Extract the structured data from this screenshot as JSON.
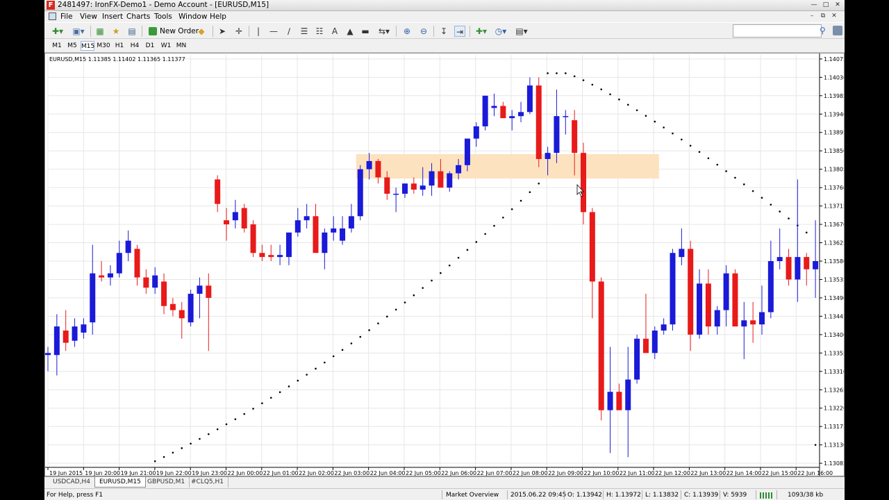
{
  "window": {
    "title": "2481497: IronFX-Demo1 - Demo Account - [EURUSD,M15]",
    "app_icon_letter": "F"
  },
  "menu": {
    "items": [
      "File",
      "View",
      "Insert",
      "Charts",
      "Tools",
      "Window",
      "Help"
    ]
  },
  "toolbar": {
    "new_order_label": "New Order",
    "search_placeholder": ""
  },
  "timeframes": {
    "items": [
      "M1",
      "M5",
      "M15",
      "M30",
      "H1",
      "H4",
      "D1",
      "W1",
      "MN"
    ],
    "active": "M15"
  },
  "chart_header": "EURUSD,M15  1.11385 1.11402 1.11365 1.11377",
  "chart_tabs": {
    "items": [
      "USDCAD,H4",
      "EURUSD,M15",
      "GBPUSD,M1",
      "#CLQ5,H1"
    ],
    "active": "EURUSD,M15"
  },
  "status": {
    "help": "For Help, press F1",
    "profile": "Market Overview",
    "datetime": "2015.06.22 09:45",
    "open": "O: 1.13942",
    "high": "H: 1.13972",
    "low": "L: 1.13832",
    "close": "C: 1.13939",
    "volume": "V: 5939",
    "traffic": "1093/38 kb"
  },
  "colors": {
    "bull": "#1a1ad8",
    "bear": "#e81a1a",
    "zone": "#fde2bf",
    "grid": "#e6e6e6"
  },
  "chart_data": {
    "type": "candlestick",
    "symbol": "EURUSD",
    "timeframe": "M15",
    "y_ticks": [
      "1.14075",
      "1.14030",
      "1.13985",
      "1.13940",
      "1.13895",
      "1.13850",
      "1.13805",
      "1.13760",
      "1.13715",
      "1.13670",
      "1.13625",
      "1.13580",
      "1.13535",
      "1.13490",
      "1.13445",
      "1.13400",
      "1.13355",
      "1.13310",
      "1.13265",
      "1.13220",
      "1.13175",
      "1.13130",
      "1.13085"
    ],
    "x_ticks": [
      "19 Jun 2015",
      "19 Jun 20:00",
      "19 Jun 21:00",
      "19 Jun 22:00",
      "19 Jun 23:00",
      "22 Jun 00:00",
      "22 Jun 01:00",
      "22 Jun 02:00",
      "22 Jun 03:00",
      "22 Jun 04:00",
      "22 Jun 05:00",
      "22 Jun 06:00",
      "22 Jun 07:00",
      "22 Jun 08:00",
      "22 Jun 09:00",
      "22 Jun 10:00",
      "22 Jun 11:00",
      "22 Jun 12:00",
      "22 Jun 13:00",
      "22 Jun 14:00",
      "22 Jun 15:00",
      "22 Jun 16:00"
    ],
    "ylim": [
      1.13075,
      1.14085
    ],
    "zone": {
      "from": 1.13782,
      "to": 1.13842,
      "start_bar": 35,
      "end_bar": 68
    },
    "candles": [
      [
        1.1335,
        1.1337,
        1.1331,
        1.13355
      ],
      [
        1.1335,
        1.1345,
        1.133,
        1.1342
      ],
      [
        1.1341,
        1.1346,
        1.1336,
        1.1338
      ],
      [
        1.13385,
        1.1344,
        1.1337,
        1.1342
      ],
      [
        1.13405,
        1.1344,
        1.1339,
        1.13425
      ],
      [
        1.1343,
        1.1362,
        1.134,
        1.1355
      ],
      [
        1.13545,
        1.1358,
        1.1353,
        1.1354
      ],
      [
        1.1354,
        1.1357,
        1.1352,
        1.1355
      ],
      [
        1.1355,
        1.1363,
        1.1354,
        1.136
      ],
      [
        1.136,
        1.13655,
        1.1358,
        1.1363
      ],
      [
        1.1361,
        1.1362,
        1.1352,
        1.1354
      ],
      [
        1.1354,
        1.1356,
        1.135,
        1.13515
      ],
      [
        1.13515,
        1.13565,
        1.135,
        1.13545
      ],
      [
        1.1353,
        1.1355,
        1.1345,
        1.1347
      ],
      [
        1.13475,
        1.1349,
        1.13445,
        1.1346
      ],
      [
        1.1346,
        1.1348,
        1.1339,
        1.1344
      ],
      [
        1.1343,
        1.1351,
        1.1342,
        1.135
      ],
      [
        1.135,
        1.1354,
        1.1344,
        1.1352
      ],
      [
        1.1352,
        1.1355,
        1.1336,
        1.1349
      ],
      [
        1.1378,
        1.1379,
        1.137,
        1.1372
      ],
      [
        1.1368,
        1.1371,
        1.1363,
        1.1367
      ],
      [
        1.1368,
        1.1373,
        1.1366,
        1.137
      ],
      [
        1.1371,
        1.1372,
        1.1365,
        1.1366
      ],
      [
        1.1367,
        1.1368,
        1.1359,
        1.136
      ],
      [
        1.136,
        1.1362,
        1.1358,
        1.1359
      ],
      [
        1.13595,
        1.1362,
        1.1358,
        1.1359
      ],
      [
        1.1359,
        1.1362,
        1.1357,
        1.13595
      ],
      [
        1.1359,
        1.1365,
        1.1357,
        1.1365
      ],
      [
        1.1365,
        1.1371,
        1.1364,
        1.1368
      ],
      [
        1.1368,
        1.1372,
        1.1366,
        1.1369
      ],
      [
        1.1369,
        1.1372,
        1.1361,
        1.136
      ],
      [
        1.136,
        1.1366,
        1.1356,
        1.1365
      ],
      [
        1.1365,
        1.1369,
        1.1363,
        1.1366
      ],
      [
        1.1363,
        1.1369,
        1.1362,
        1.1366
      ],
      [
        1.1366,
        1.1372,
        1.1365,
        1.1369
      ],
      [
        1.1369,
        1.13815,
        1.1368,
        1.13805
      ],
      [
        1.13805,
        1.13845,
        1.1378,
        1.13825
      ],
      [
        1.13825,
        1.1383,
        1.1377,
        1.13785
      ],
      [
        1.13785,
        1.138,
        1.1373,
        1.13745
      ],
      [
        1.13745,
        1.1376,
        1.137,
        1.13745
      ],
      [
        1.13745,
        1.1377,
        1.13735,
        1.1377
      ],
      [
        1.1377,
        1.13785,
        1.13745,
        1.13755
      ],
      [
        1.13755,
        1.1381,
        1.1374,
        1.13765
      ],
      [
        1.13765,
        1.1382,
        1.1374,
        1.138
      ],
      [
        1.138,
        1.1383,
        1.1376,
        1.1376
      ],
      [
        1.1376,
        1.138,
        1.1375,
        1.13795
      ],
      [
        1.13795,
        1.1383,
        1.1378,
        1.13815
      ],
      [
        1.13815,
        1.1387,
        1.138,
        1.1388
      ],
      [
        1.1388,
        1.1392,
        1.1386,
        1.1391
      ],
      [
        1.1391,
        1.13985,
        1.139,
        1.13985
      ],
      [
        1.13955,
        1.1399,
        1.13935,
        1.1396
      ],
      [
        1.1396,
        1.1397,
        1.1393,
        1.1393
      ],
      [
        1.1393,
        1.1395,
        1.139,
        1.13935
      ],
      [
        1.13935,
        1.1397,
        1.1392,
        1.13945
      ],
      [
        1.13945,
        1.1403,
        1.1394,
        1.1401
      ],
      [
        1.1401,
        1.1403,
        1.1381,
        1.1383
      ],
      [
        1.1383,
        1.1386,
        1.1379,
        1.13845
      ],
      [
        1.13845,
        1.14,
        1.1382,
        1.13935
      ],
      [
        1.13935,
        1.1395,
        1.1389,
        1.13935
      ],
      [
        1.13925,
        1.1395,
        1.1379,
        1.13845
      ],
      [
        1.13845,
        1.1387,
        1.1367,
        1.137
      ],
      [
        1.137,
        1.1371,
        1.1344,
        1.1353
      ],
      [
        1.1353,
        1.1354,
        1.1319,
        1.13215
      ],
      [
        1.13215,
        1.1337,
        1.1311,
        1.1326
      ],
      [
        1.1326,
        1.1328,
        1.1322,
        1.13215
      ],
      [
        1.13215,
        1.1337,
        1.131,
        1.1329
      ],
      [
        1.1329,
        1.134,
        1.1328,
        1.1339
      ],
      [
        1.1339,
        1.135,
        1.1337,
        1.13355
      ],
      [
        1.13355,
        1.1342,
        1.1334,
        1.1341
      ],
      [
        1.1341,
        1.1344,
        1.134,
        1.13425
      ],
      [
        1.13425,
        1.1361,
        1.1341,
        1.136
      ],
      [
        1.1359,
        1.1366,
        1.1357,
        1.1361
      ],
      [
        1.1361,
        1.1363,
        1.1336,
        1.134
      ],
      [
        1.134,
        1.1356,
        1.1339,
        1.13525
      ],
      [
        1.13525,
        1.1356,
        1.134,
        1.1342
      ],
      [
        1.1342,
        1.1347,
        1.134,
        1.1346
      ],
      [
        1.1346,
        1.1357,
        1.1342,
        1.1355
      ],
      [
        1.1355,
        1.1356,
        1.1342,
        1.1342
      ],
      [
        1.1342,
        1.1348,
        1.1334,
        1.13435
      ],
      [
        1.13435,
        1.1348,
        1.1338,
        1.13425
      ],
      [
        1.13425,
        1.1352,
        1.134,
        1.13455
      ],
      [
        1.13455,
        1.1363,
        1.1344,
        1.1358
      ],
      [
        1.1358,
        1.1366,
        1.1356,
        1.1359
      ],
      [
        1.1359,
        1.1361,
        1.1352,
        1.13535
      ],
      [
        1.13535,
        1.1378,
        1.1348,
        1.1359
      ],
      [
        1.1359,
        1.136,
        1.1352,
        1.1356
      ],
      [
        1.1356,
        1.1368,
        1.1349,
        1.1358
      ]
    ],
    "sar_start": 1.1309,
    "sar_peak": 1.1404,
    "sar_peak_bar": 58,
    "sar_end": 1.1313
  }
}
